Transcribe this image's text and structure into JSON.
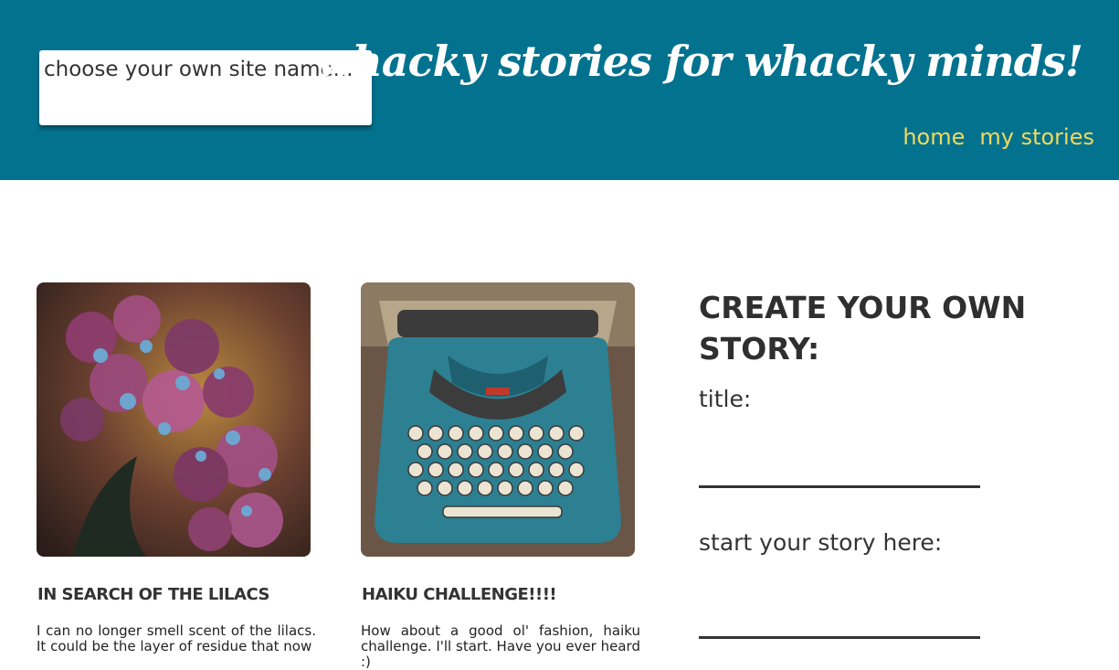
{
  "header": {
    "site_name_placeholder": "choose your own site name...",
    "tagline": "whacky stories for whacky minds!",
    "nav": {
      "home": "home",
      "my_stories": "my stories"
    }
  },
  "cards": [
    {
      "image": "lilac-flowers-photo",
      "title": "IN SEARCH OF THE LILACS",
      "excerpt": "I can no longer smell scent of the lilacs. It could be the layer of residue that now"
    },
    {
      "image": "typewriter-photo",
      "title": "HAIKU CHALLENGE!!!!",
      "excerpt": "How about a good ol' fashion, haiku challenge. I'll start. Have you ever heard :)"
    }
  ],
  "create": {
    "heading": "CREATE YOUR OWN STORY:",
    "title_label": "title:",
    "story_label": "start your story here:"
  },
  "colors": {
    "header_bg": "#03728f",
    "nav_link": "#f2d95c",
    "text": "#333333"
  }
}
